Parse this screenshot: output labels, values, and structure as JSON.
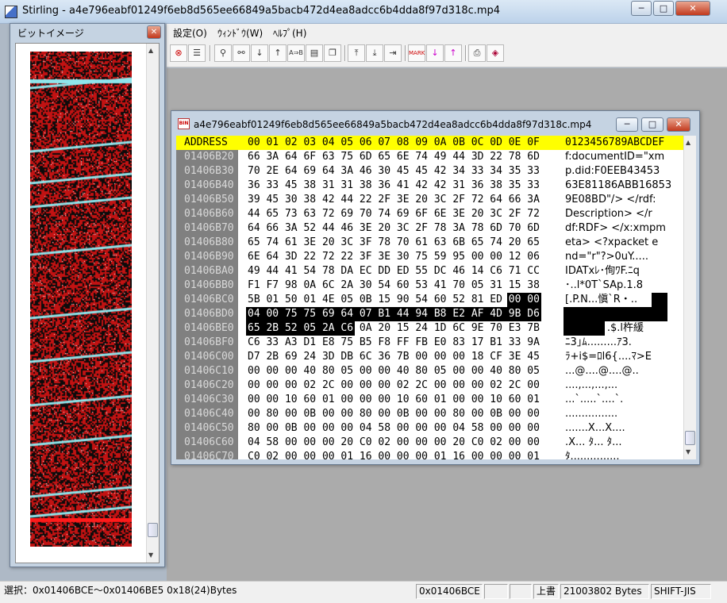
{
  "app": {
    "title": "Stirling - a4e796eabf01249f6eb8d565ee66849a5bacb472d4ea8adcc6b4dda8f97d318c.mp4",
    "caption_buttons": {
      "minimize": "─",
      "maximize": "□",
      "close": "✕"
    }
  },
  "menu": {
    "items": [
      {
        "label": "設定(O)"
      },
      {
        "label": "ｳｨﾝﾄﾞｳ(W)"
      },
      {
        "label": "ﾍﾙﾌﾟ(H)"
      }
    ]
  },
  "toolbar": {
    "icons": [
      "delete-icon",
      "list-icon",
      "find-icon",
      "find-replace-icon",
      "find-next-icon",
      "find-prev-icon",
      "compare-icon",
      "book-icon",
      "copy-file-icon",
      "jump-top-icon",
      "jump-down-icon",
      "jump-end-icon",
      "mark-icon",
      "mark-next-icon",
      "mark-prev-icon",
      "print-icon",
      "help-book-icon"
    ]
  },
  "bit_panel": {
    "title": "ビットイメージ",
    "close_label": "✕",
    "colors": {
      "background": "#c21212",
      "noise": "#0b0b0b",
      "stripe": "#8ee6ec"
    }
  },
  "hex_window": {
    "title": "a4e796eabf01249f6eb8d565ee66849a5bacb472d4ea8adcc6b4dda8f97d318c.mp4",
    "file_icon_label": "BIN",
    "header": {
      "address": "ADDRESS",
      "columns": "00 01 02 03 04 05 06 07 08 09 0A 0B 0C 0D 0E 0F",
      "ascii": "0123456789ABCDEF"
    },
    "rows": [
      {
        "address": "01406B20",
        "hex": "66 3A 64 6F 63 75 6D 65 6E 74 49 44 3D 22 78 6D",
        "ascii": "f:documentID=\"xm"
      },
      {
        "address": "01406B30",
        "hex": "70 2E 64 69 64 3A 46 30 45 45 42 34 33 34 35 33",
        "ascii": "p.did:F0EEB43453"
      },
      {
        "address": "01406B40",
        "hex": "36 33 45 38 31 31 38 36 41 42 42 31 36 38 35 33",
        "ascii": "63E81186ABB16853"
      },
      {
        "address": "01406B50",
        "hex": "39 45 30 38 42 44 22 2F 3E 20 3C 2F 72 64 66 3A",
        "ascii": "9E08BD\"/> </rdf:"
      },
      {
        "address": "01406B60",
        "hex": "44 65 73 63 72 69 70 74 69 6F 6E 3E 20 3C 2F 72",
        "ascii": "Description> </r"
      },
      {
        "address": "01406B70",
        "hex": "64 66 3A 52 44 46 3E 20 3C 2F 78 3A 78 6D 70 6D",
        "ascii": "df:RDF> </x:xmpm"
      },
      {
        "address": "01406B80",
        "hex": "65 74 61 3E 20 3C 3F 78 70 61 63 6B 65 74 20 65",
        "ascii": "eta> <?xpacket e"
      },
      {
        "address": "01406B90",
        "hex": "6E 64 3D 22 72 22 3F 3E 30 75 59 95 00 00 12 06",
        "ascii": "nd=\"r\"?>0uY....."
      },
      {
        "address": "01406BA0",
        "hex": "49 44 41 54 78 DA EC DD ED 55 DC 46 14 C6 71 CC",
        "ascii": "IDATxﾚ･侚ﾜF.ﾆq"
      },
      {
        "address": "01406BB0",
        "hex": "F1 F7 98 0A 6C 2A 30 54 60 53 41 70 05 31 15 38",
        "ascii": "･..l*0T`SAp.1.8"
      },
      {
        "address": "01406BC0",
        "hex": "5B 01 50 01 4E 05 0B 15 90 54 60 52 81 ED 00 00",
        "ascii": "[.P.N...愼`R・..",
        "hl_hex_from": 14,
        "hl_ascii_from": 14
      },
      {
        "address": "01406BD0",
        "hex": "04 00 75 75 69 64 07 B1 44 94 B8 E2 AF 4D 9B D6",
        "ascii": "..uuid.ｱD枸竡M嶝",
        "hl_hex_from": 0,
        "hl_ascii_from": 0
      },
      {
        "address": "01406BE0",
        "hex": "65 2B 52 05 2A C6 0A 20 15 24 1D 6C 9E 70 E3 7B",
        "ascii": "e+R.*ﾆ. .$.l杵緩",
        "hl_hex_to": 6,
        "hl_ascii_to": 6
      },
      {
        "address": "01406BF0",
        "hex": "C6 33 A3 D1 E8 75 B5 F8 FF FB E0 83 17 B1 33 9A",
        "ascii": "ﾆ3｣ﾑ.........ｱ3."
      },
      {
        "address": "01406C00",
        "hex": "D7 2B 69 24 3D DB 6C 36 7B 00 00 00 18 CF 3E 45",
        "ascii": "ﾗ+i$=ﾛl6{....ﾏ>E"
      },
      {
        "address": "01406C10",
        "hex": "00 00 00 40 80 05 00 00 40 80 05 00 00 40 80 05",
        "ascii": "...@....@....@.."
      },
      {
        "address": "01406C20",
        "hex": "00 00 00 02 2C 00 00 00 02 2C 00 00 00 02 2C 00",
        "ascii": "....,...,...,..."
      },
      {
        "address": "01406C30",
        "hex": "00 00 10 60 01 00 00 00 10 60 01 00 00 10 60 01",
        "ascii": "...`.....`....`."
      },
      {
        "address": "01406C40",
        "hex": "00 80 00 0B 00 00 80 00 0B 00 00 80 00 0B 00 00",
        "ascii": "................"
      },
      {
        "address": "01406C50",
        "hex": "80 00 0B 00 00 00 04 58 00 00 00 04 58 00 00 00",
        "ascii": ".......X...X...."
      },
      {
        "address": "01406C60",
        "hex": "04 58 00 00 00 20 C0 02 00 00 00 20 C0 02 00 00",
        "ascii": ".X... ﾀ... ﾀ..."
      },
      {
        "address": "01406C70",
        "hex": "C0 02 00 00 00 01 16 00 00 00 01 16 00 00 00 01",
        "ascii": "ﾀ..............."
      }
    ],
    "colors": {
      "header_bg": "#ffff00",
      "address_bg": "#808080",
      "selection_bg": "#000000"
    }
  },
  "status": {
    "selection": "選択：0x01406BCE〜0x01406BE5  0x18(24)Bytes",
    "offset": "0x01406BCE",
    "mode": "上書",
    "size": "21003802 Bytes",
    "encoding": "SHIFT-JIS"
  }
}
